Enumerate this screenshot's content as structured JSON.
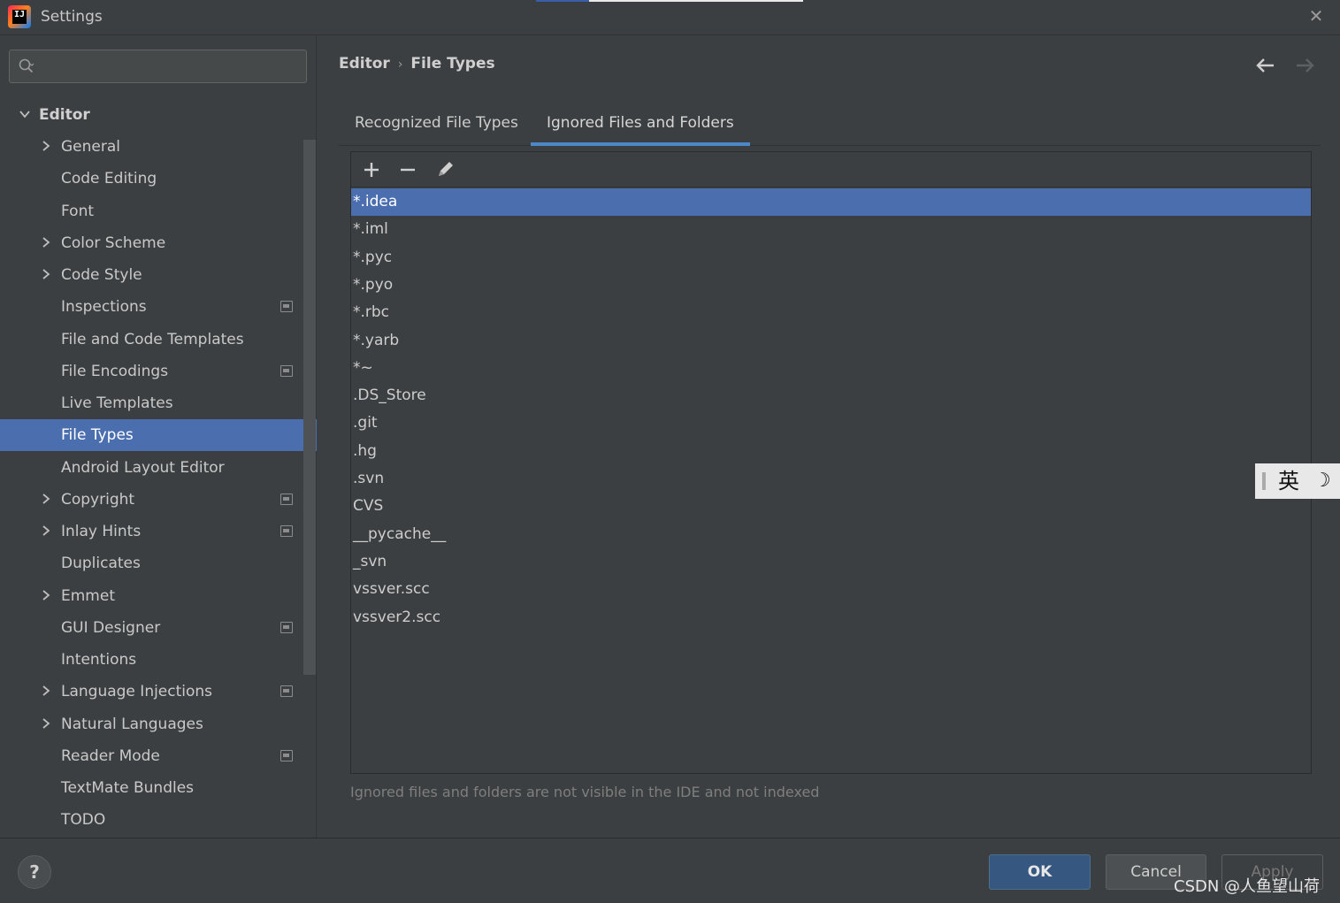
{
  "window": {
    "title": "Settings",
    "app_icon_text": "IJ",
    "close_glyph": "✕"
  },
  "sidebar": {
    "search": {
      "value": "",
      "placeholder": ""
    },
    "root": {
      "label": "Editor",
      "expanded": true
    },
    "items": [
      {
        "label": "General",
        "expandable": true,
        "project_scoped": false
      },
      {
        "label": "Code Editing",
        "expandable": false,
        "project_scoped": false
      },
      {
        "label": "Font",
        "expandable": false,
        "project_scoped": false
      },
      {
        "label": "Color Scheme",
        "expandable": true,
        "project_scoped": false
      },
      {
        "label": "Code Style",
        "expandable": true,
        "project_scoped": false
      },
      {
        "label": "Inspections",
        "expandable": false,
        "project_scoped": true
      },
      {
        "label": "File and Code Templates",
        "expandable": false,
        "project_scoped": false
      },
      {
        "label": "File Encodings",
        "expandable": false,
        "project_scoped": true
      },
      {
        "label": "Live Templates",
        "expandable": false,
        "project_scoped": false
      },
      {
        "label": "File Types",
        "expandable": false,
        "project_scoped": false,
        "selected": true
      },
      {
        "label": "Android Layout Editor",
        "expandable": false,
        "project_scoped": false
      },
      {
        "label": "Copyright",
        "expandable": true,
        "project_scoped": true
      },
      {
        "label": "Inlay Hints",
        "expandable": true,
        "project_scoped": true
      },
      {
        "label": "Duplicates",
        "expandable": false,
        "project_scoped": false
      },
      {
        "label": "Emmet",
        "expandable": true,
        "project_scoped": false
      },
      {
        "label": "GUI Designer",
        "expandable": false,
        "project_scoped": true
      },
      {
        "label": "Intentions",
        "expandable": false,
        "project_scoped": false
      },
      {
        "label": "Language Injections",
        "expandable": true,
        "project_scoped": true
      },
      {
        "label": "Natural Languages",
        "expandable": true,
        "project_scoped": false
      },
      {
        "label": "Reader Mode",
        "expandable": false,
        "project_scoped": true
      },
      {
        "label": "TextMate Bundles",
        "expandable": false,
        "project_scoped": false
      },
      {
        "label": "TODO",
        "expandable": false,
        "project_scoped": false
      }
    ]
  },
  "breadcrumb": {
    "parent": "Editor",
    "separator": "›",
    "current": "File Types"
  },
  "tabs": [
    {
      "label": "Recognized File Types",
      "active": false
    },
    {
      "label": "Ignored Files and Folders",
      "active": true
    }
  ],
  "toolbar": {
    "add_icon": "plus-icon",
    "remove_icon": "minus-icon",
    "edit_icon": "pencil-icon"
  },
  "ignored_list": [
    "*.idea",
    "*.iml",
    "*.pyc",
    "*.pyo",
    "*.rbc",
    "*.yarb",
    "*~",
    ".DS_Store",
    ".git",
    ".hg",
    ".svn",
    "CVS",
    "__pycache__",
    "_svn",
    "vssver.scc",
    "vssver2.scc"
  ],
  "selected_row": 0,
  "hint": "Ignored files and folders are not visible in the IDE and not indexed",
  "ime": {
    "label": "英",
    "moon": "☽"
  },
  "footer": {
    "help": "?",
    "ok": "OK",
    "cancel": "Cancel",
    "apply": "Apply",
    "watermark": "CSDN @人鱼望山荷"
  },
  "colors": {
    "background": "#3c3f41",
    "selection": "#4b6eaf",
    "tab_underline": "#4a88c7",
    "ok_button": "#365880"
  }
}
